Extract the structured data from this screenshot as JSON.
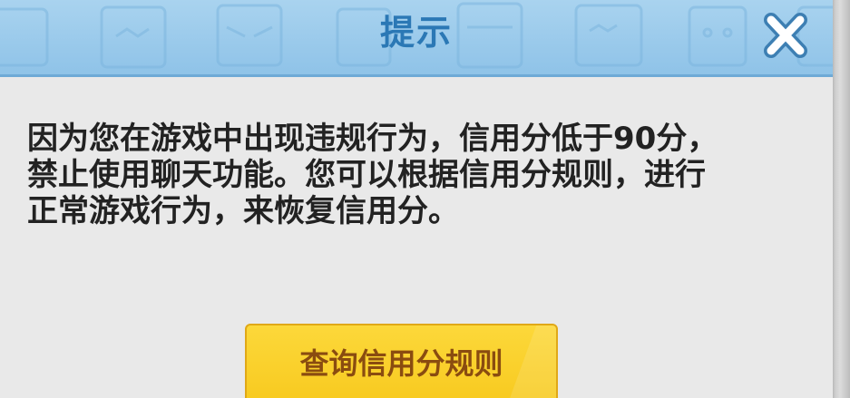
{
  "dialog": {
    "title": "提示",
    "message": "因为您在游戏中出现违规行为，信用分低于90分，\n禁止使用聊天功能。您可以根据信用分规则，进行\n正常游戏行为，来恢复信用分。",
    "action_button_label": "查询信用分规则",
    "close_icon": "close-icon"
  },
  "colors": {
    "header_bg": "#9ccbec",
    "title_text": "#2b78b5",
    "body_bg": "#e9e9e9",
    "message_text": "#222222",
    "button_bg": "#f9cf2a",
    "button_text": "#8a4c10"
  }
}
